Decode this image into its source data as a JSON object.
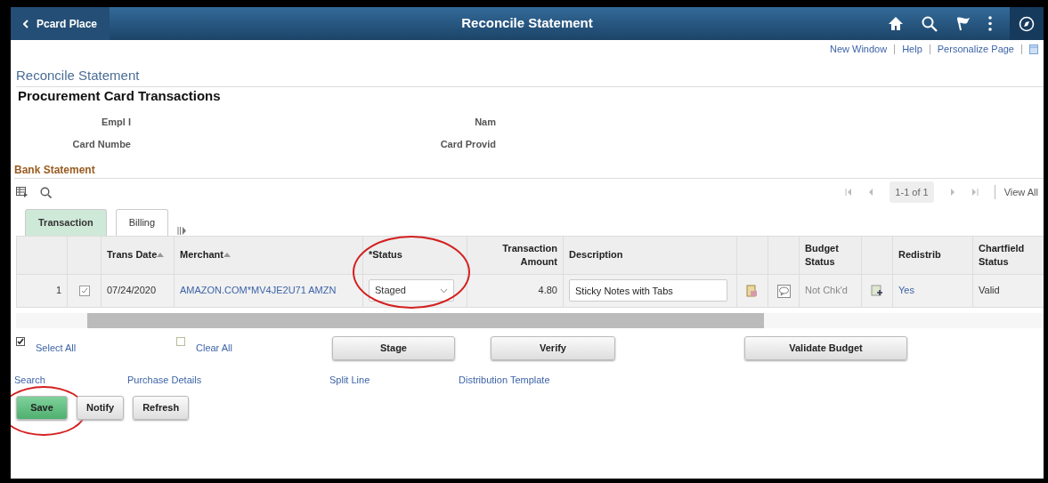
{
  "header": {
    "back_label": "Pcard Place",
    "title": "Reconcile Statement"
  },
  "top_links": [
    "New Window",
    "Help",
    "Personalize Page"
  ],
  "page_title": "Reconcile Statement",
  "section_title": "Procurement Card Transactions",
  "fields": [
    {
      "label": "Empl I"
    },
    {
      "label": "Nam"
    },
    {
      "label": "Card Numbe"
    },
    {
      "label": "Card Provid"
    }
  ],
  "grid": {
    "title": "Bank Statement",
    "pager": "1-1 of 1",
    "view_all": "View All",
    "tabs": [
      {
        "label": "Transaction",
        "selected": true
      },
      {
        "label": "Billing",
        "selected": false
      }
    ],
    "columns": [
      {
        "kind": "blank"
      },
      {
        "kind": "blank"
      },
      {
        "kind": "text",
        "label": "Trans Date",
        "sorted": true
      },
      {
        "kind": "text",
        "label": "Merchant",
        "sorted": true
      },
      {
        "kind": "text",
        "label": "*Status",
        "sorted": false,
        "circled": true
      },
      {
        "kind": "numeric",
        "label": "Transaction Amount",
        "sorted": false
      },
      {
        "kind": "text",
        "label": "Description",
        "sorted": false
      },
      {
        "kind": "blank"
      },
      {
        "kind": "blank"
      },
      {
        "kind": "text",
        "label": "Budget Status",
        "sorted": false
      },
      {
        "kind": "blank"
      },
      {
        "kind": "text",
        "label": "Redistrib",
        "sorted": false
      },
      {
        "kind": "text",
        "label": "Chartfield Status",
        "sorted": false
      }
    ],
    "rows": [
      {
        "cells": [
          {
            "kind": "num",
            "text": "1"
          },
          {
            "kind": "check",
            "checked": true
          },
          {
            "kind": "text",
            "text": "07/24/2020"
          },
          {
            "kind": "link",
            "text": "AMAZON.COM*MV4JE2U71 AMZN"
          },
          {
            "kind": "select",
            "value": "Staged"
          },
          {
            "kind": "amount",
            "text": "4.80"
          },
          {
            "kind": "input",
            "value": "Sticky Notes with Tabs"
          },
          {
            "kind": "attachment"
          },
          {
            "kind": "comment"
          },
          {
            "kind": "muted",
            "text": "Not Chk'd"
          },
          {
            "kind": "distribute"
          },
          {
            "kind": "link",
            "text": "Yes"
          },
          {
            "kind": "text",
            "text": "Valid"
          }
        ]
      }
    ]
  },
  "selection": [
    {
      "label": "Select All",
      "checked": true
    },
    {
      "label": "Clear All",
      "checked": false
    }
  ],
  "grid_buttons": [
    "Stage",
    "Verify",
    "Validate Budget"
  ],
  "links": [
    "Search",
    "Purchase Details",
    "Split Line",
    "Distribution Template"
  ],
  "buttons": [
    {
      "label": "Save",
      "primary": true,
      "circled": true
    },
    {
      "label": "Notify",
      "primary": false,
      "circled": false
    },
    {
      "label": "Refresh",
      "primary": false,
      "circled": false
    }
  ]
}
